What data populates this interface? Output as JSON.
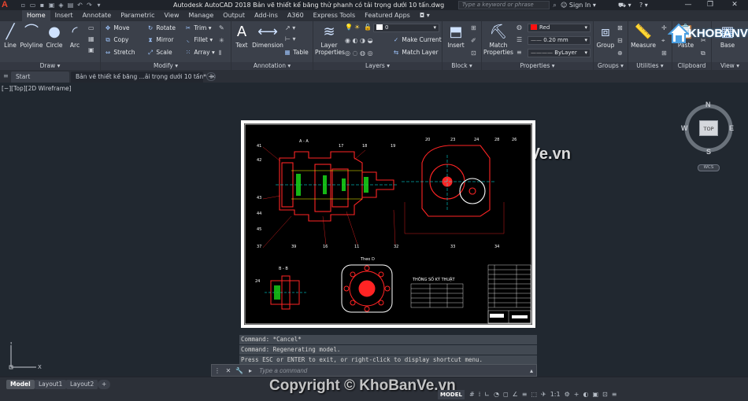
{
  "titlebar": {
    "app_logo": "A",
    "window_title": "Autodesk AutoCAD 2018    Bản vẽ thiết kế băng thử phanh có tải trọng dưới 10 tấn.dwg",
    "search_placeholder": "Type a keyword or phrase",
    "sign_in": "Sign In",
    "minimize": "—",
    "maximize": "❐",
    "close": "✕"
  },
  "ribbon_tabs": [
    "Home",
    "Insert",
    "Annotate",
    "Parametric",
    "View",
    "Manage",
    "Output",
    "Add-ins",
    "A360",
    "Express Tools",
    "Featured Apps"
  ],
  "ribbon": {
    "draw": {
      "title": "Draw ▾",
      "line": "Line",
      "polyline": "Polyline",
      "circle": "Circle",
      "arc": "Arc"
    },
    "modify": {
      "title": "Modify ▾",
      "move": "Move",
      "rotate": "Rotate",
      "trim": "Trim ▾",
      "copy": "Copy",
      "mirror": "Mirror",
      "fillet": "Fillet ▾",
      "stretch": "Stretch",
      "scale": "Scale",
      "array": "Array ▾"
    },
    "annotation": {
      "title": "Annotation ▾",
      "text": "Text",
      "dimension": "Dimension",
      "table": "Table"
    },
    "layers": {
      "title": "Layers ▾",
      "layer_properties": "Layer Properties",
      "layer_value": "0",
      "make_current": "Make Current",
      "match_layer": "Match Layer"
    },
    "block": {
      "title": "Block ▾",
      "insert": "Insert"
    },
    "properties": {
      "title": "Properties ▾",
      "match_properties": "Match Properties",
      "color_value": "Red",
      "lineweight_value": "0.20 mm",
      "linetype_value": "ByLayer"
    },
    "groups": {
      "title": "Groups ▾",
      "group": "Group"
    },
    "utilities": {
      "title": "Utilities ▾",
      "measure": "Measure"
    },
    "clipboard": {
      "title": "Clipboard",
      "paste": "Paste"
    },
    "view": {
      "title": "View ▾",
      "base": "Base"
    }
  },
  "doc_tabs": {
    "start": "Start",
    "drawing": "Bản vẽ thiết kế băng ...ải trọng dưới 10 tấn*",
    "close": "✕",
    "new": "+"
  },
  "viewport": {
    "label": "[−][Top][2D Wireframe]",
    "compass": {
      "n": "N",
      "s": "S",
      "e": "E",
      "w": "W",
      "face": "TOP",
      "wcs": "WCS"
    }
  },
  "watermarks": {
    "logo_text": "KHOBANVE",
    "mid_text": "KhoBanVe.vn",
    "copyright": "Copyright © KhoBanVe.vn"
  },
  "drawing_labels": {
    "section_aa": "A - A",
    "section_bb": "B - B",
    "view_d": "Theo D",
    "specs_title": "THÔNG SỐ KỸ THUẬT"
  },
  "command": {
    "history": [
      "Command: *Cancel*",
      "Command: Regenerating model.",
      "Press ESC or ENTER to exit, or right-click to display shortcut menu."
    ],
    "placeholder": "Type a command",
    "btn_close": "✕",
    "btn_wrench": "🔧",
    "btn_prompt": "▸"
  },
  "layout_tabs": [
    "Model",
    "Layout1",
    "Layout2"
  ],
  "layout_add": "+",
  "status": {
    "model": "MODEL",
    "scale": "1:1"
  },
  "colors": {
    "accent": "#4a90d9",
    "background": "#212830",
    "ribbon": "#3b404a",
    "drawing_line": "#ff2020"
  }
}
